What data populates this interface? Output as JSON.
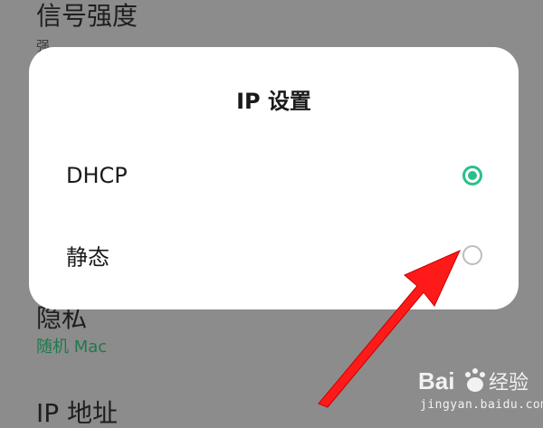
{
  "background": {
    "signal_title": "信号强度",
    "signal_value": "强",
    "privacy_title": "隐私",
    "privacy_value": "随机 Mac",
    "ip_address_title": "IP 地址"
  },
  "dialog": {
    "title": "IP 设置",
    "options": [
      {
        "label": "DHCP",
        "selected": true
      },
      {
        "label": "静态",
        "selected": false
      }
    ]
  },
  "colors": {
    "accent": "#2bbf8a",
    "arrow": "#ff1a1a",
    "scrim": "#8c8c8c"
  },
  "watermark": {
    "brand_text": "Bai経验",
    "url": "jingyan.baidu.com"
  }
}
